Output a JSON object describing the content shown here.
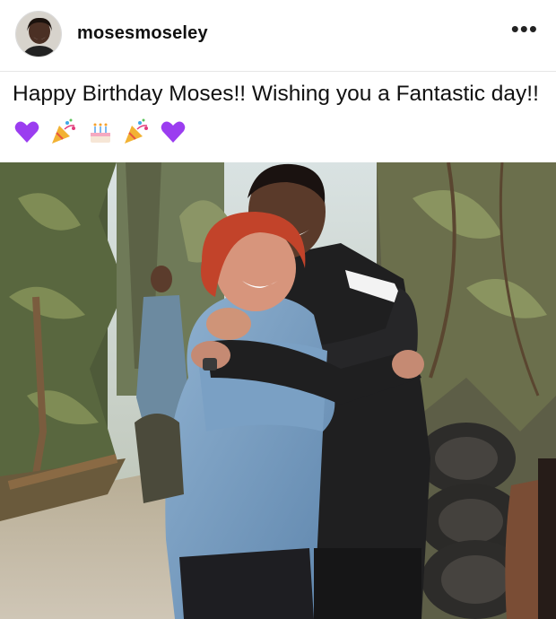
{
  "post": {
    "username": "mosesmoseley",
    "more_icon": "more-horizontal-icon",
    "caption_text": "Happy Birthday Moses!! Wishing you a Fantastic day!!",
    "caption_emojis": [
      "purple-heart-icon",
      "party-popper-icon",
      "birthday-cake-icon",
      "party-popper-icon",
      "purple-heart-icon"
    ]
  },
  "colors": {
    "heart": "#9b3df0",
    "text": "#111111",
    "divider": "#e6e6e6"
  }
}
